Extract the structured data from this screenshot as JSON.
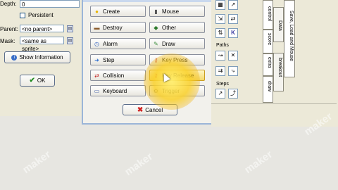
{
  "left_panel": {
    "depth_label": "Depth:",
    "depth_value": "0",
    "persistent_label": "Persistent",
    "parent_label": "Parent:",
    "parent_value": "<no parent>",
    "mask_label": "Mask:",
    "mask_value": "<same as sprite>",
    "show_information_label": "Show Information",
    "ok_label": "OK"
  },
  "event_dialog": {
    "events": [
      {
        "label": "Create",
        "icon": "lightbulb-icon",
        "color": "#e8b400"
      },
      {
        "label": "Mouse",
        "icon": "mouse-icon",
        "color": "#555555"
      },
      {
        "label": "Destroy",
        "icon": "trash-icon",
        "color": "#8a5a2a"
      },
      {
        "label": "Other",
        "icon": "diamond-icon",
        "color": "#2c7a2c"
      },
      {
        "label": "Alarm",
        "icon": "clock-icon",
        "color": "#3060c0"
      },
      {
        "label": "Draw",
        "icon": "pencil-icon",
        "color": "#3d8f3d"
      },
      {
        "label": "Step",
        "icon": "steps-icon",
        "color": "#3070d0"
      },
      {
        "label": "Key Press",
        "icon": "key-icon",
        "color": "#c04040"
      },
      {
        "label": "Collision",
        "icon": "arrows-icon",
        "color": "#c02020"
      },
      {
        "label": "Key Release",
        "icon": "key-icon",
        "color": "#c04040"
      },
      {
        "label": "Keyboard",
        "icon": "keyboard-icon",
        "color": "#3050a0"
      },
      {
        "label": "Trigger",
        "icon": "gear-icon",
        "color": "#606060"
      }
    ],
    "cancel_label": "Cancel"
  },
  "right_panel": {
    "paths_label": "Paths",
    "steps_label": "Steps",
    "tabs": [
      "control",
      "score",
      "extra",
      "draw",
      "Data",
      "Save, Load and Mouse",
      "breakout"
    ]
  },
  "watermark": "maker"
}
